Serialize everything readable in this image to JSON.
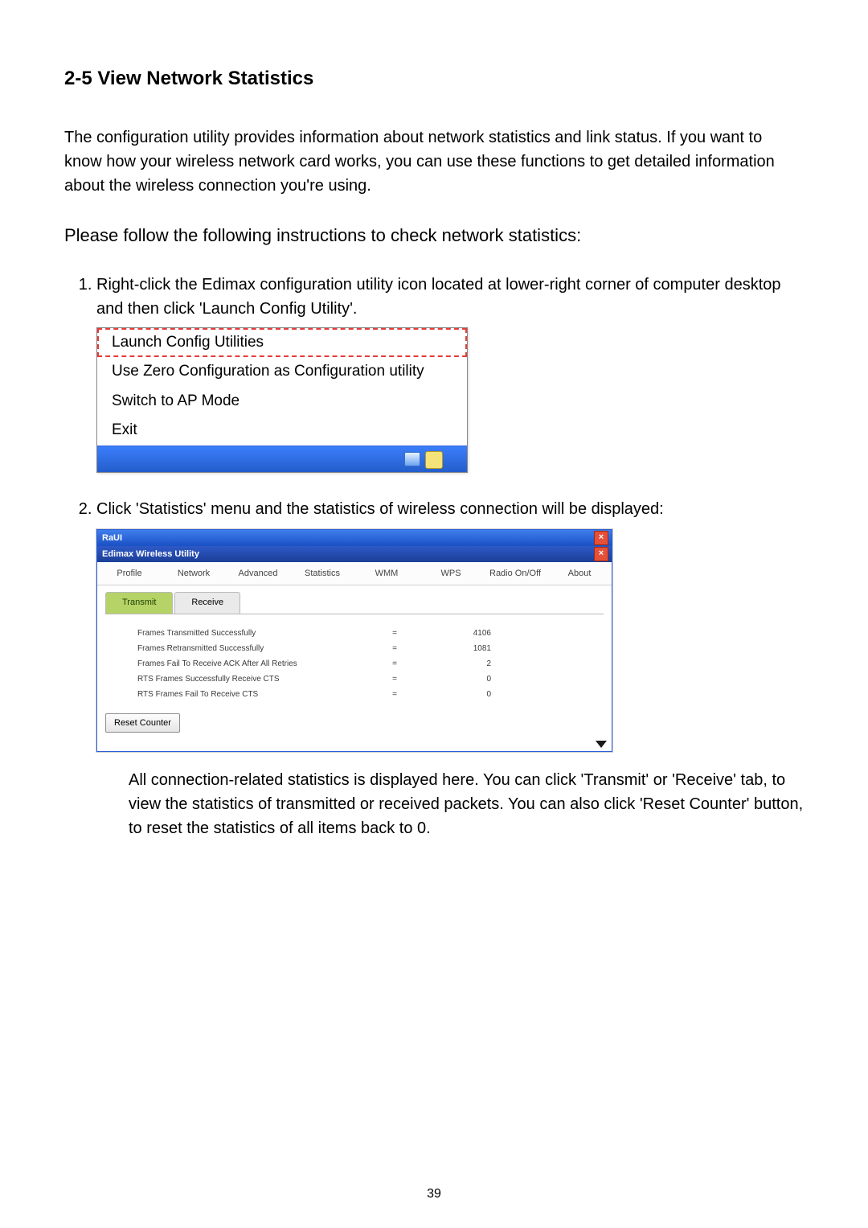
{
  "heading": "2-5 View Network Statistics",
  "intro": "The configuration utility provides information about network statistics and link status. If you want to know how your wireless network card works, you can use these functions to get detailed information about the wireless connection you're using.",
  "instruction": "Please follow the following instructions to check network statistics:",
  "steps": [
    "Right-click the Edimax configuration utility icon located at lower-right corner of computer desktop and then click 'Launch Config Utility'.",
    "Click 'Statistics' menu and the statistics of wireless connection will be displayed:"
  ],
  "context_menu": {
    "items": [
      "Launch Config Utilities",
      "Use Zero Configuration as Configuration utility",
      "Switch to AP Mode",
      "Exit"
    ]
  },
  "window": {
    "outer_title": "RaUI",
    "inner_title": "Edimax Wireless Utility",
    "menus": [
      "Profile",
      "Network",
      "Advanced",
      "Statistics",
      "WMM",
      "WPS",
      "Radio On/Off",
      "About"
    ],
    "tabs": {
      "active": "Transmit",
      "other": "Receive"
    },
    "stats": [
      {
        "label": "Frames Transmitted Successfully",
        "value": "4106"
      },
      {
        "label": "Frames Retransmitted Successfully",
        "value": "1081"
      },
      {
        "label": "Frames Fail To Receive ACK After All Retries",
        "value": "2"
      },
      {
        "label": "RTS Frames Successfully Receive CTS",
        "value": "0"
      },
      {
        "label": "RTS Frames Fail To Receive CTS",
        "value": "0"
      }
    ],
    "reset_button": "Reset Counter"
  },
  "closing": "All connection-related statistics is displayed here. You can click 'Transmit' or 'Receive' tab, to view the statistics of transmitted or received packets. You can also click 'Reset Counter' button, to reset the statistics of all items back to 0.",
  "page_number": "39"
}
